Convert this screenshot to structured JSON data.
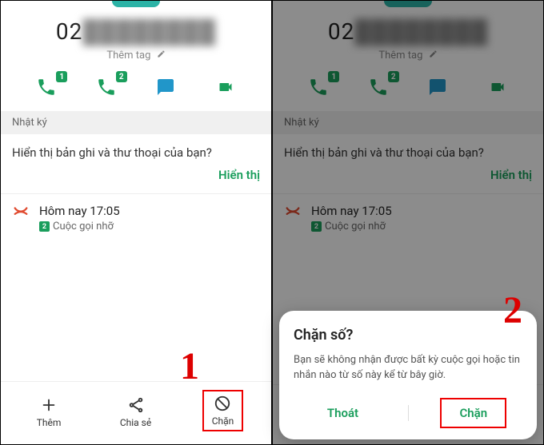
{
  "colors": {
    "accent": "#1a9e5c",
    "missed": "#e04a2f",
    "highlight": "#e00"
  },
  "phone": {
    "prefix": "02",
    "blurred": "XXXXXXXX"
  },
  "tag": {
    "label": "Thêm tag",
    "icon": "edit-icon"
  },
  "actions": {
    "sim1": {
      "icon": "phone-icon",
      "badge": "1"
    },
    "sim2": {
      "icon": "phone-icon",
      "badge": "2"
    },
    "message": {
      "icon": "message-icon"
    },
    "video": {
      "icon": "video-icon"
    }
  },
  "section": {
    "log_label": "Nhật ký"
  },
  "voicemail_card": {
    "prompt": "Hiển thị bản ghi và thư thoại của bạn?",
    "action": "Hiển thị"
  },
  "log_entry": {
    "title": "Hôm nay 17:05",
    "sim_badge": "2",
    "subtitle": "Cuộc gọi nhỡ"
  },
  "bottom": {
    "add": {
      "label": "Thêm",
      "icon": "plus-icon"
    },
    "share": {
      "label": "Chia sẻ",
      "icon": "share-icon"
    },
    "block": {
      "label": "Chặn",
      "icon": "block-icon"
    }
  },
  "dialog": {
    "title": "Chặn số?",
    "body": "Bạn sẽ không nhận được bất kỳ cuộc gọi hoặc tin nhắn nào từ số này kể từ bây giờ.",
    "cancel": "Thoát",
    "confirm": "Chặn"
  },
  "steps": {
    "one": "1",
    "two": "2"
  }
}
